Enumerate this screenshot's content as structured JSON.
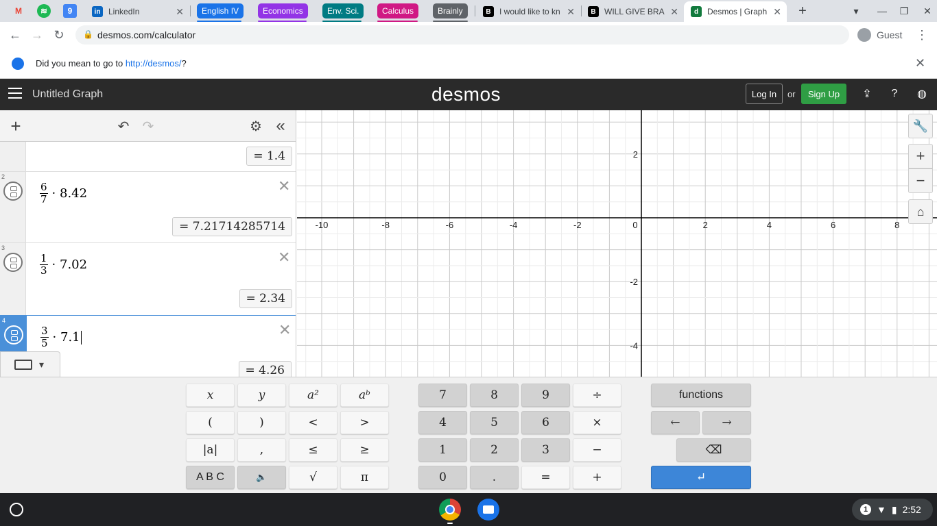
{
  "browser": {
    "pinned_tabs": [
      {
        "icon": "gmail-icon",
        "glyph": "M",
        "color": "#ea4335"
      },
      {
        "icon": "spotify-icon",
        "glyph": "≋",
        "color": "#1db954"
      },
      {
        "icon": "google-calendar-icon",
        "glyph": "9",
        "color": "#4285f4"
      }
    ],
    "tabs": [
      {
        "title": "LinkedIn",
        "favicon_glyph": "in"
      },
      {
        "title": "I would like to kn",
        "favicon_glyph": "B"
      },
      {
        "title": "WILL GIVE BRAIN",
        "favicon_glyph": "B"
      },
      {
        "title": "Desmos | Graph",
        "favicon_glyph": "d"
      }
    ],
    "tab_groups": [
      {
        "label": "English IV",
        "color": "#1a73e8"
      },
      {
        "label": "Economics",
        "color": "#9334e6"
      },
      {
        "label": "Env. Sci.",
        "color": "#007b83"
      },
      {
        "label": "Calculus",
        "color": "#d01884"
      },
      {
        "label": "Brainly",
        "color": "#5f6368"
      }
    ],
    "url": "desmos.com/calculator",
    "profile_label": "Guest",
    "infobar": {
      "message_prefix": "Did you mean to go to ",
      "link_text": "http://desmos/",
      "message_suffix": "?"
    }
  },
  "desmos": {
    "graph_title": "Untitled Graph",
    "logo": "desmos",
    "login_label": "Log In",
    "or_label": "or",
    "signup_label": "Sign Up",
    "expressions": [
      {
        "index": "",
        "numerator": "",
        "denominator": "",
        "rest": "",
        "result": "=  1.4"
      },
      {
        "index": "2",
        "numerator": "6",
        "denominator": "7",
        "rest": "· 8.42",
        "result": "=  7.21714285714"
      },
      {
        "index": "3",
        "numerator": "1",
        "denominator": "3",
        "rest": "· 7.02",
        "result": "=  2.34"
      },
      {
        "index": "4",
        "numerator": "3",
        "denominator": "5",
        "rest": "· 7.1",
        "result": "=  4.26"
      }
    ],
    "axis": {
      "x_ticks": [
        "-10",
        "-8",
        "-6",
        "-4",
        "-2",
        "0",
        "2",
        "4",
        "6",
        "8"
      ],
      "y_ticks": [
        "2",
        "-2",
        "-4"
      ]
    },
    "keypad": {
      "left": [
        [
          "x",
          "y",
          "a²",
          "aᵇ"
        ],
        [
          "(",
          ")",
          "<",
          ">"
        ],
        [
          "|a|",
          ",",
          "≤",
          "≥"
        ],
        [
          "A B C",
          "🔈",
          "√",
          "π"
        ]
      ],
      "middle": [
        [
          "7",
          "8",
          "9",
          "÷"
        ],
        [
          "4",
          "5",
          "6",
          "×"
        ],
        [
          "1",
          "2",
          "3",
          "−"
        ],
        [
          "0",
          ".",
          "=",
          "+"
        ]
      ],
      "functions_label": "functions",
      "left_arrow": "←",
      "right_arrow": "→",
      "backspace": "⌫",
      "enter": "↵"
    }
  },
  "shelf": {
    "notification_count": "1",
    "time": "2:52"
  }
}
